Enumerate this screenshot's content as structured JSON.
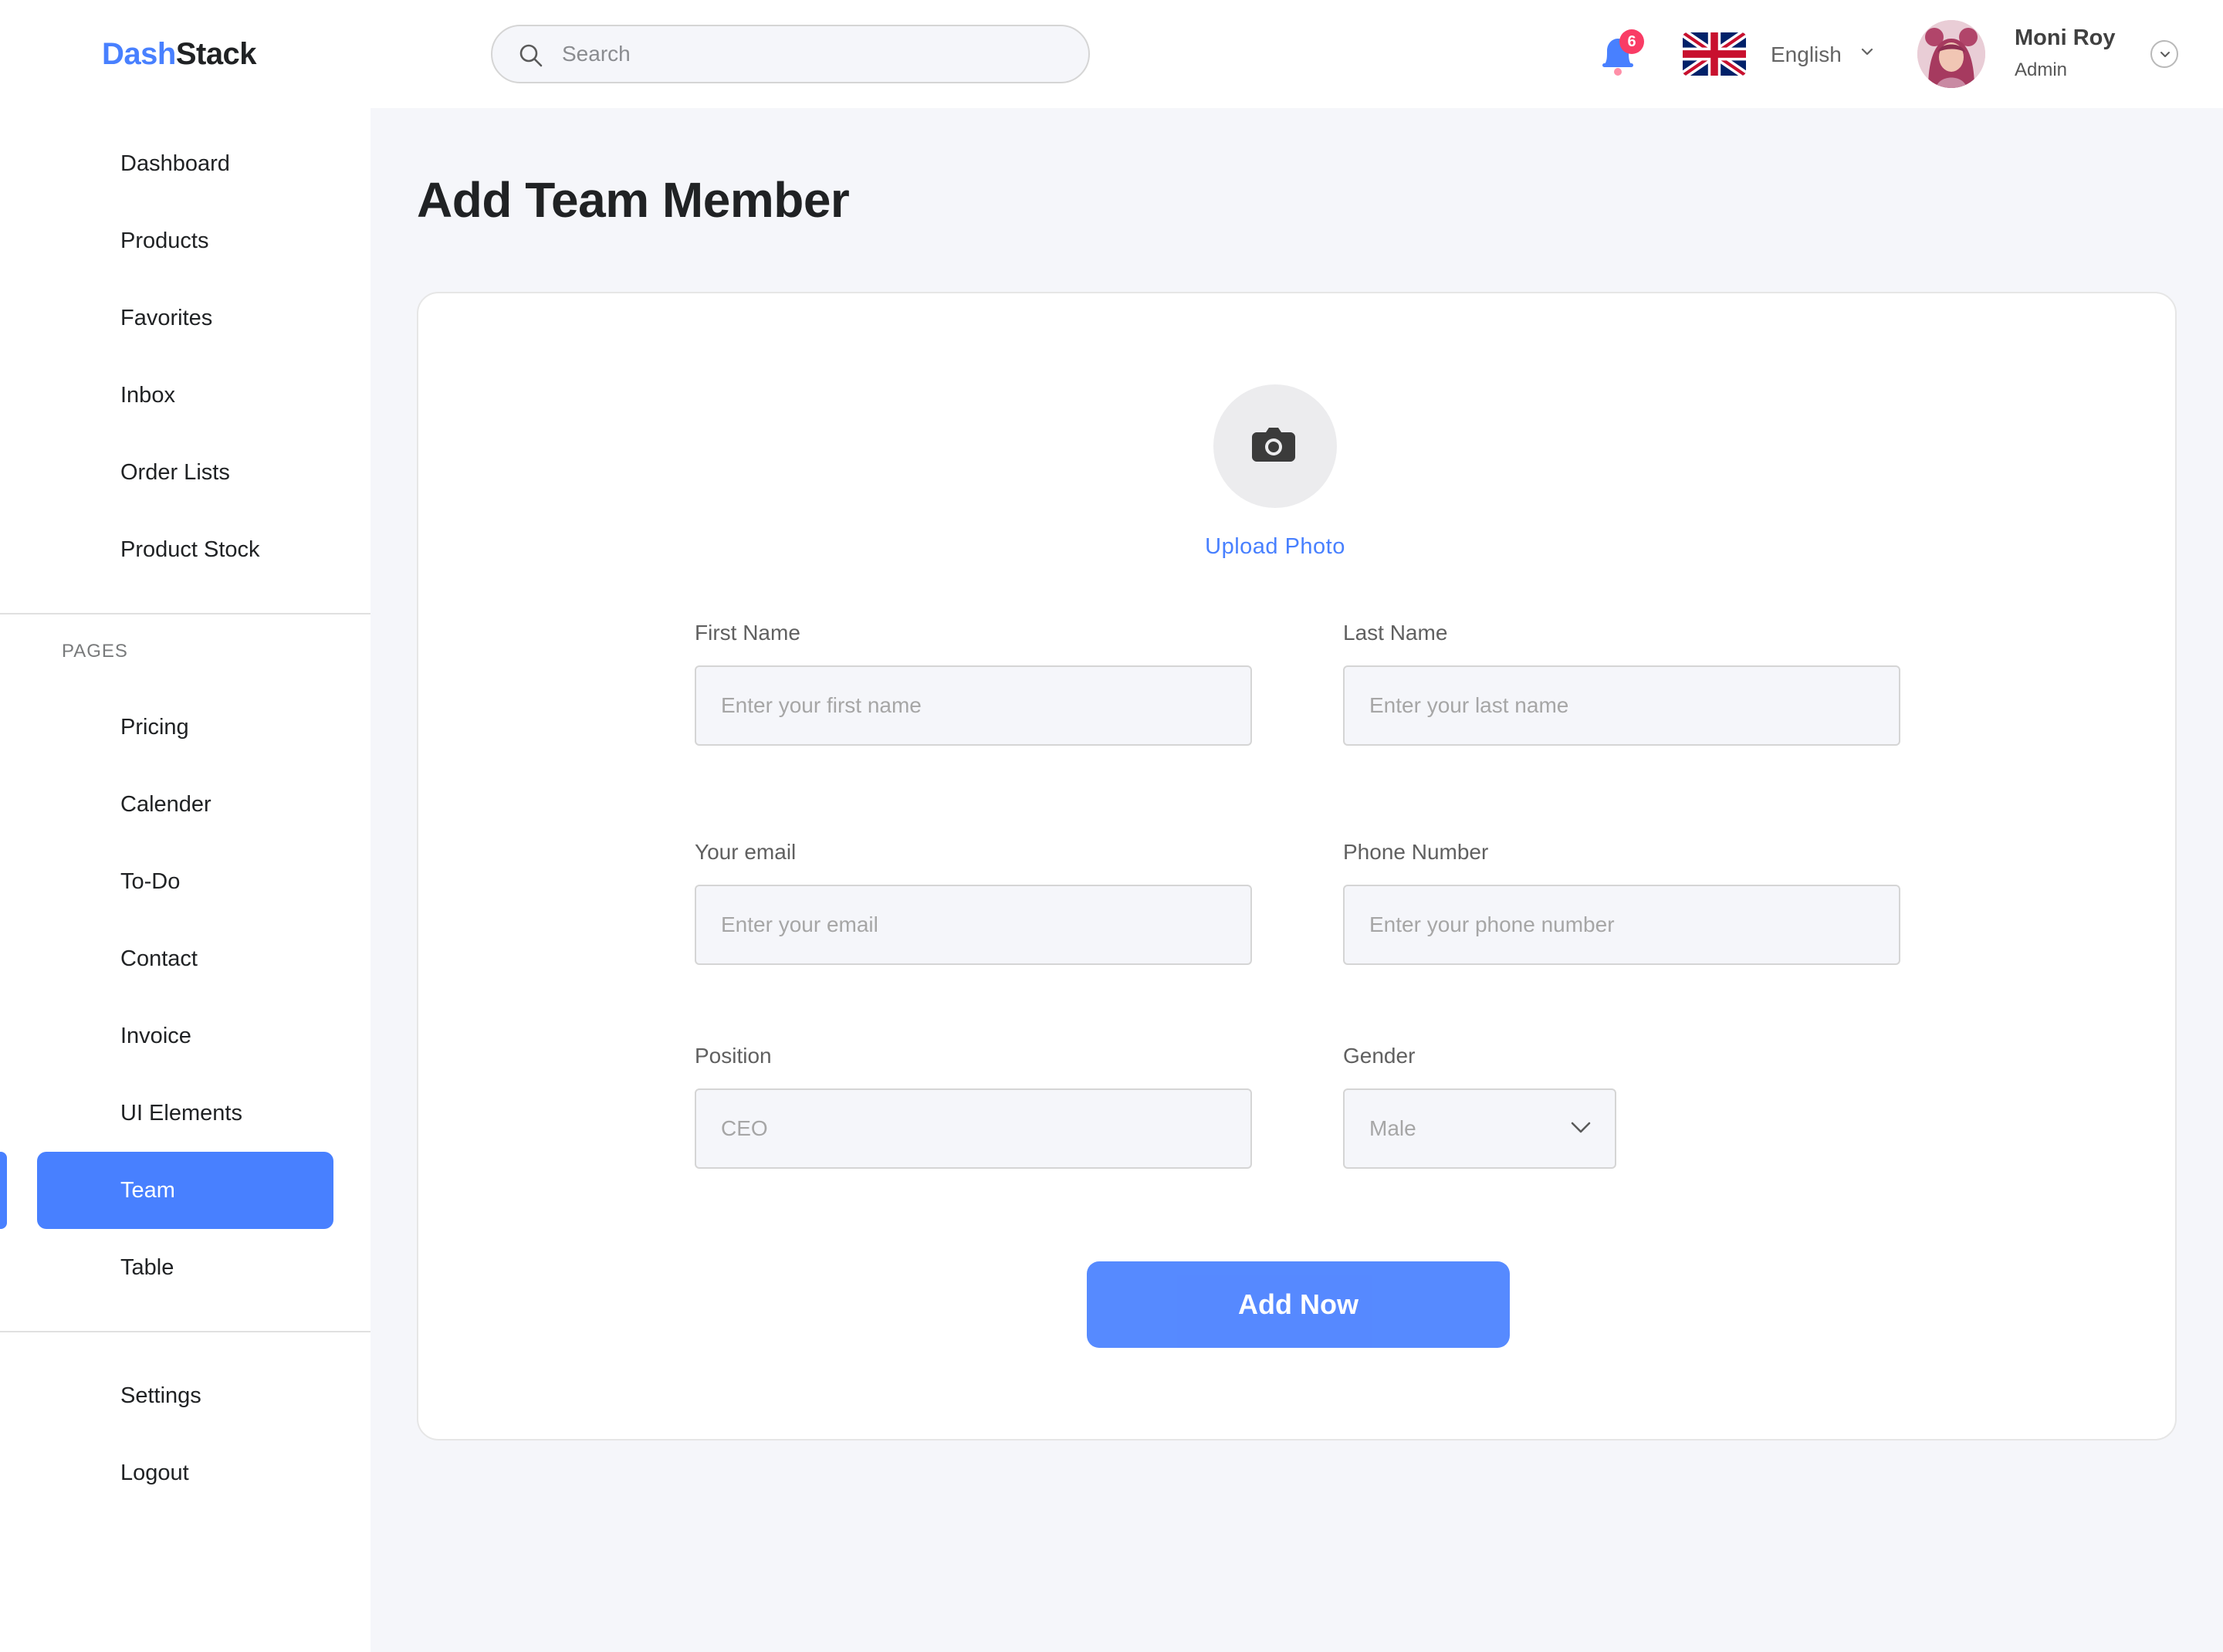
{
  "brand": {
    "part1": "Dash",
    "part2": "Stack"
  },
  "search": {
    "placeholder": "Search"
  },
  "notifications": {
    "count": "6",
    "icon": "bell-icon"
  },
  "language": {
    "label": "English",
    "flag": "uk-flag-icon"
  },
  "user": {
    "name": "Moni Roy",
    "role": "Admin"
  },
  "sidebar": {
    "main_items": [
      {
        "label": "Dashboard"
      },
      {
        "label": "Products"
      },
      {
        "label": "Favorites"
      },
      {
        "label": "Inbox"
      },
      {
        "label": "Order Lists"
      },
      {
        "label": "Product Stock"
      }
    ],
    "pages_label": "PAGES",
    "pages_items": [
      {
        "label": "Pricing"
      },
      {
        "label": "Calender"
      },
      {
        "label": "To-Do"
      },
      {
        "label": "Contact"
      },
      {
        "label": "Invoice"
      },
      {
        "label": "UI Elements"
      },
      {
        "label": "Team",
        "active": true
      },
      {
        "label": "Table"
      }
    ],
    "bottom_items": [
      {
        "label": "Settings"
      },
      {
        "label": "Logout"
      }
    ]
  },
  "page": {
    "title": "Add Team Member"
  },
  "form": {
    "upload_label": "Upload Photo",
    "first_name": {
      "label": "First Name",
      "placeholder": "Enter your first name"
    },
    "last_name": {
      "label": "Last Name",
      "placeholder": "Enter your last name"
    },
    "email": {
      "label": "Your email",
      "placeholder": "Enter your email"
    },
    "phone": {
      "label": "Phone Number",
      "placeholder": "Enter your phone number"
    },
    "position": {
      "label": "Position",
      "placeholder": "CEO"
    },
    "gender": {
      "label": "Gender",
      "value": "Male"
    },
    "submit_label": "Add Now"
  },
  "colors": {
    "accent": "#4880ff",
    "badge": "#f93c65",
    "background": "#f5f6fa"
  }
}
